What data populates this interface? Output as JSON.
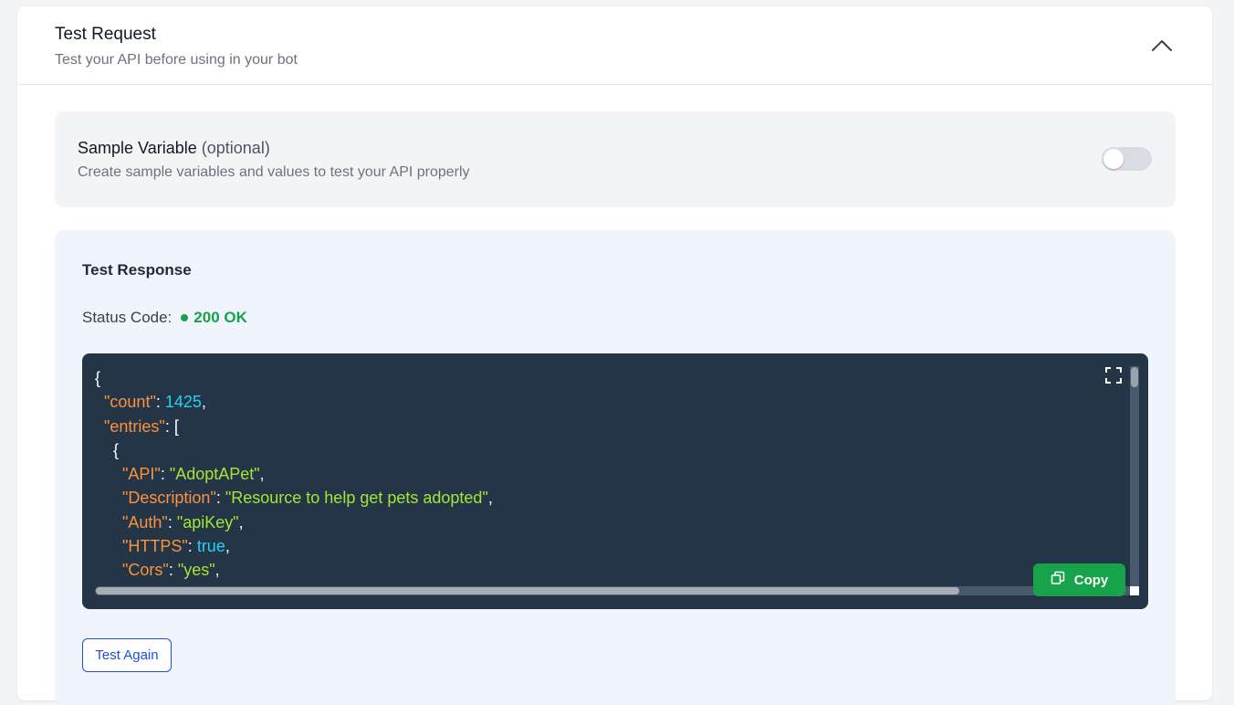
{
  "header": {
    "title": "Test Request",
    "subtitle": "Test your API before using in your bot",
    "collapse_icon": "chevron-up-icon"
  },
  "sample_variable": {
    "title": "Sample Variable",
    "optional": "(optional)",
    "description": "Create sample variables and values to test your API properly",
    "toggle_on": false
  },
  "response": {
    "title": "Test Response",
    "status_label": "Status Code:",
    "status_value": "200 OK",
    "status_color": "#16a34a",
    "code": {
      "l1_brace": "{",
      "l2_key": "\"count\"",
      "l2_val": "1425",
      "l3_key": "\"entries\"",
      "l3_open": "[",
      "l4_brace": "{",
      "l5_key": "\"API\"",
      "l5_val": "\"AdoptAPet\"",
      "l6_key": "\"Description\"",
      "l6_val": "\"Resource to help get pets adopted\"",
      "l7_key": "\"Auth\"",
      "l7_val": "\"apiKey\"",
      "l8_key": "\"HTTPS\"",
      "l8_val": "true",
      "l9_key": "\"Cors\"",
      "l9_val": "\"yes\""
    },
    "copy_label": "Copy",
    "expand_icon": "fullscreen-icon",
    "test_again_label": "Test Again"
  }
}
